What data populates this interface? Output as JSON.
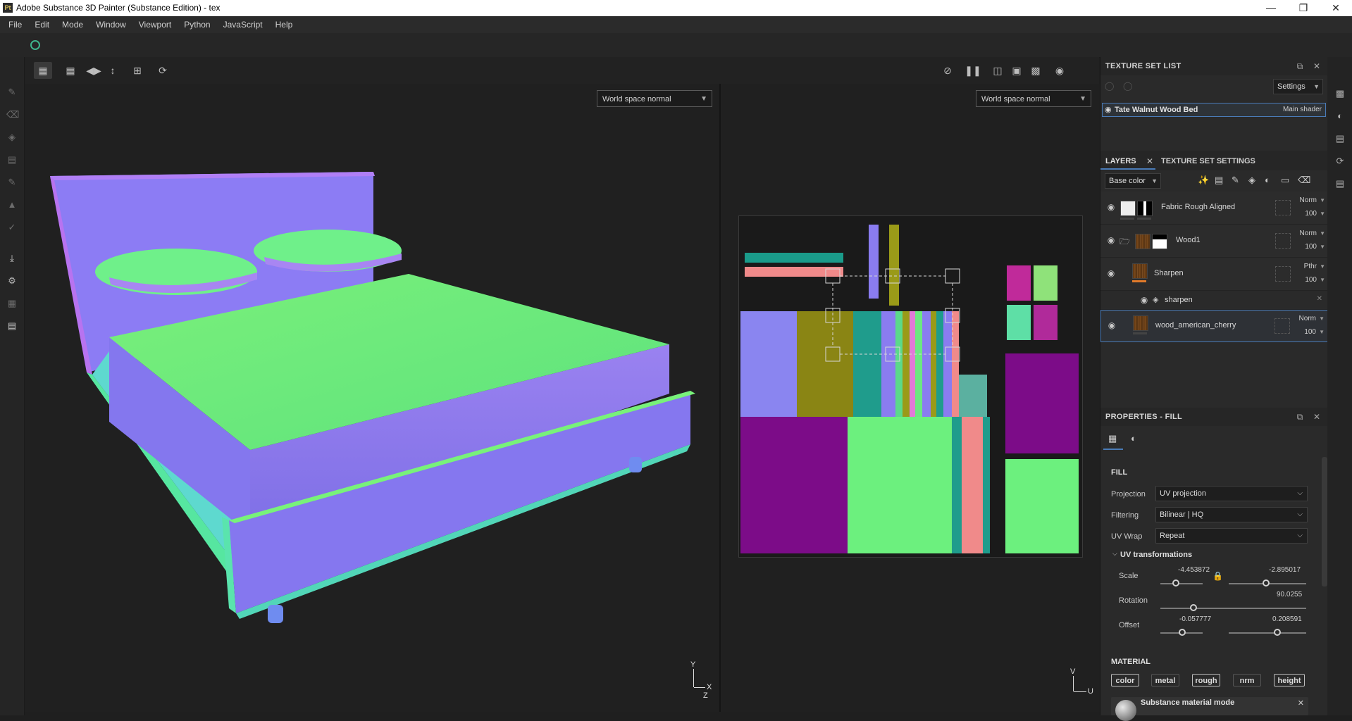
{
  "window": {
    "title": "Adobe Substance 3D Painter (Substance Edition) - tex",
    "app_icon": "Pt",
    "controls": [
      "minimize-icon",
      "maximize-icon",
      "close-icon"
    ]
  },
  "menu": [
    "File",
    "Edit",
    "Mode",
    "Window",
    "Viewport",
    "Python",
    "JavaScript",
    "Help"
  ],
  "viewport": {
    "left_channel": "World space normal",
    "right_channel": "World space normal",
    "axis_left": {
      "y": "Y",
      "x": "X",
      "z": "Z"
    },
    "axis_right": {
      "v": "V",
      "u": "U"
    }
  },
  "texture_set_list": {
    "title": "TEXTURE SET LIST",
    "settings_label": "Settings",
    "set_name": "Tate Walnut Wood Bed",
    "shader": "Main shader"
  },
  "layers_panel": {
    "tabs": [
      "LAYERS",
      "TEXTURE SET SETTINGS"
    ],
    "channel": "Base color",
    "layers": [
      {
        "name": "Fabric Rough Aligned",
        "blend": "Norm",
        "opacity": "100"
      },
      {
        "name": "Wood1",
        "blend": "Norm",
        "opacity": "100"
      },
      {
        "name": "Sharpen",
        "blend": "Pthr",
        "opacity": "100"
      },
      {
        "name": "sharpen",
        "blend": "",
        "opacity": ""
      },
      {
        "name": "wood_american_cherry",
        "blend": "Norm",
        "opacity": "100"
      }
    ]
  },
  "properties": {
    "title": "PROPERTIES - FILL",
    "section_fill": "FILL",
    "projection_label": "Projection",
    "projection_value": "UV projection",
    "filtering_label": "Filtering",
    "filtering_value": "Bilinear | HQ",
    "uvwrap_label": "UV Wrap",
    "uvwrap_value": "Repeat",
    "uv_transform_title": "UV transformations",
    "scale_label": "Scale",
    "scale_u": "-4.453872",
    "scale_v": "-2.895017",
    "rotation_label": "Rotation",
    "rotation_value": "90.0255",
    "offset_label": "Offset",
    "offset_u": "-0.057777",
    "offset_v": "0.208591",
    "material_title": "MATERIAL",
    "material_channels": [
      "color",
      "metal",
      "rough",
      "nrm",
      "height"
    ],
    "material_mode_title": "Substance material mode"
  }
}
